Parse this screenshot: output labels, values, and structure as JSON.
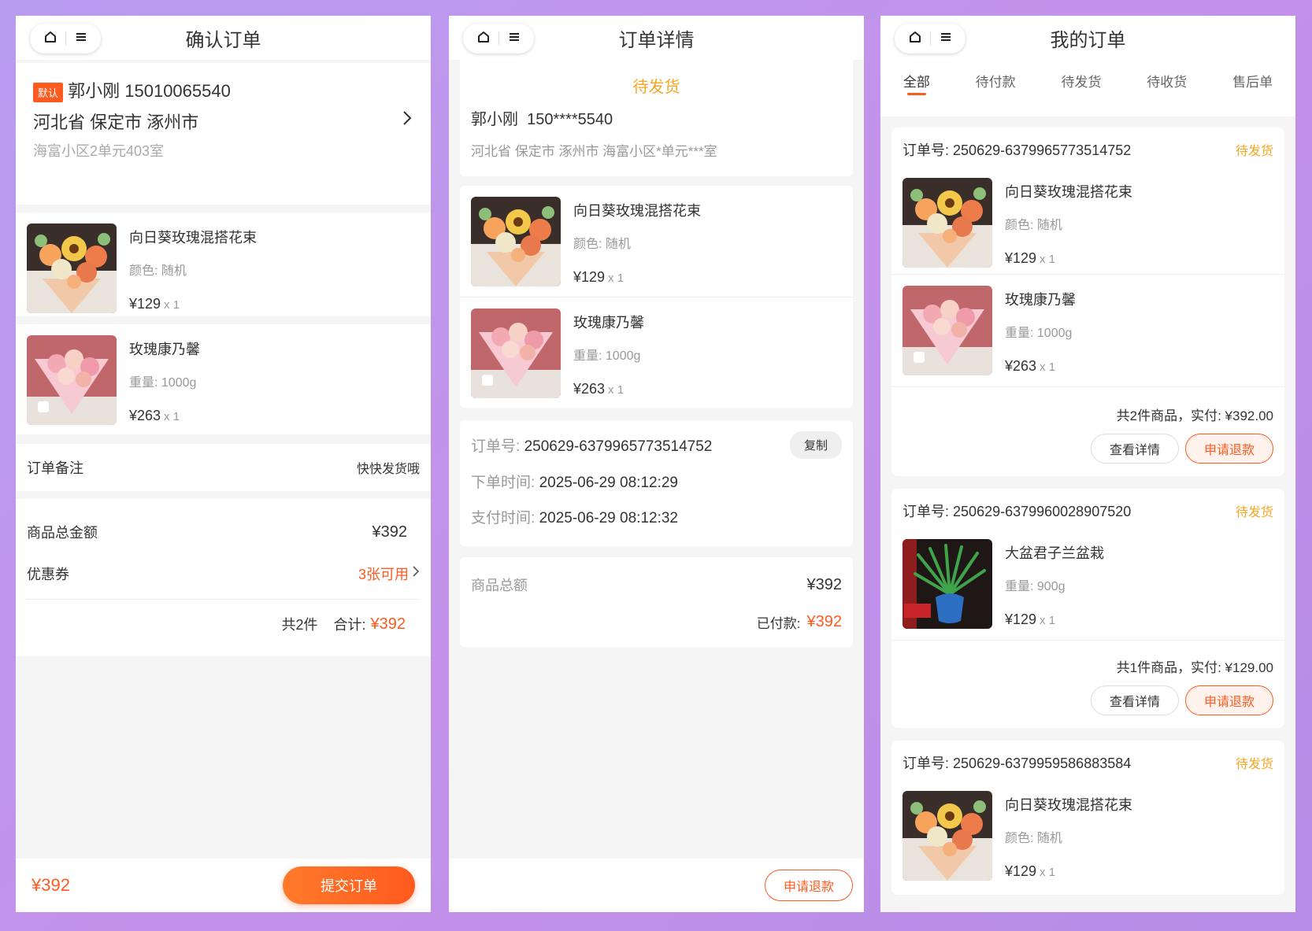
{
  "confirm": {
    "title": "确认订单",
    "address": {
      "tag": "默认",
      "name_phone": "郭小刚 15010065540",
      "region": "河北省 保定市 涿州市",
      "detail": "海富小区2单元403室"
    },
    "items": [
      {
        "name": "向日葵玫瑰混搭花束",
        "spec": "颜色: 随机",
        "price": "¥129",
        "qty": "x 1"
      },
      {
        "name": "玫瑰康乃馨",
        "spec": "重量: 1000g",
        "price": "¥263",
        "qty": "x 1"
      }
    ],
    "remark_label": "订单备注",
    "remark_value": "快快发货哦",
    "total_label": "商品总金额",
    "total_value": "¥392",
    "coupon_label": "优惠券",
    "coupon_value": "3张可用",
    "summary_count": "共2件",
    "summary_label": "合计:",
    "summary_value": "¥392",
    "bottom_price": "¥392",
    "submit_label": "提交订单"
  },
  "detail": {
    "title": "订单详情",
    "status": "待发货",
    "name_phone": "郭小刚  150****5540",
    "address": "河北省 保定市 涿州市 海富小区*单元***室",
    "items": [
      {
        "name": "向日葵玫瑰混搭花束",
        "spec": "颜色: 随机",
        "price": "¥129",
        "qty": "x 1"
      },
      {
        "name": "玫瑰康乃馨",
        "spec": "重量: 1000g",
        "price": "¥263",
        "qty": "x 1"
      }
    ],
    "order_no_label": "订单号:",
    "order_no": "250629-6379965773514752",
    "copy_label": "复制",
    "order_time_label": "下单时间:",
    "order_time": "2025-06-29 08:12:29",
    "pay_time_label": "支付时间:",
    "pay_time": "2025-06-29 08:12:32",
    "goods_total_label": "商品总额",
    "goods_total": "¥392",
    "paid_label": "已付款:",
    "paid_value": "¥392",
    "refund_label": "申请退款"
  },
  "orders": {
    "title": "我的订单",
    "tabs": [
      "全部",
      "待付款",
      "待发货",
      "待收货",
      "售后单"
    ],
    "order_no_label": "订单号:",
    "detail_btn": "查看详情",
    "refund_btn": "申请退款",
    "list": [
      {
        "no": "250629-6379965773514752",
        "status": "待发货",
        "items": [
          {
            "name": "向日葵玫瑰混搭花束",
            "spec": "颜色: 随机",
            "price": "¥129",
            "qty": "x 1"
          },
          {
            "name": "玫瑰康乃馨",
            "spec": "重量: 1000g",
            "price": "¥263",
            "qty": "x 1"
          }
        ],
        "summary": "共2件商品，实付: ¥392.00"
      },
      {
        "no": "250629-6379960028907520",
        "status": "待发货",
        "items": [
          {
            "name": "大盆君子兰盆栽",
            "spec": "重量: 900g",
            "price": "¥129",
            "qty": "x 1"
          }
        ],
        "summary": "共1件商品，实付: ¥129.00"
      },
      {
        "no": "250629-6379959586883584",
        "status": "待发货",
        "items": [
          {
            "name": "向日葵玫瑰混搭花束",
            "spec": "颜色: 随机",
            "price": "¥129",
            "qty": "x 1"
          }
        ]
      }
    ]
  },
  "theme": {
    "accent": "#ff5a1f",
    "status": "#f5a623"
  }
}
